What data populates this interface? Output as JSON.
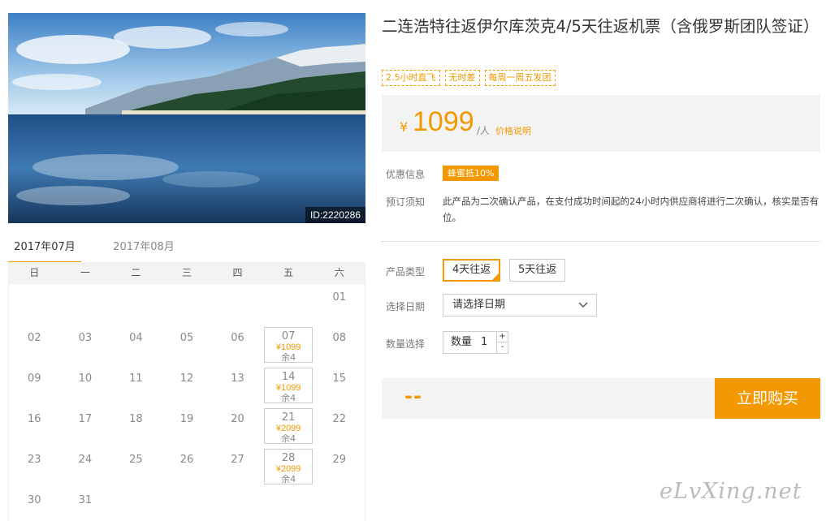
{
  "hero": {
    "image_id": "ID:2220286"
  },
  "product": {
    "title": "二连浩特往返伊尔库茨克4/5天往返机票（含俄罗斯团队签证）",
    "tags": [
      "2.5小时直飞",
      "无时差",
      "每周一周五发团"
    ]
  },
  "price": {
    "currency": "¥",
    "amount": "1099",
    "unit": "/人",
    "explain_link": "价格说明"
  },
  "promo": {
    "label": "优惠信息",
    "badge": "蜂蜜抵10%"
  },
  "notice": {
    "label": "预订须知",
    "text": "此产品为二次确认产品，在支付成功时间起的24小时内供应商将进行二次确认，核实是否有位。"
  },
  "options": {
    "type_label": "产品类型",
    "types": [
      "4天往返",
      "5天往返"
    ],
    "selected_type": "4天往返",
    "date_label": "选择日期",
    "date_placeholder": "请选择日期",
    "qty_label": "数量选择",
    "qty_text": "数量",
    "qty_value": "1",
    "plus": "+",
    "minus": "-"
  },
  "buy": {
    "total": "--",
    "button": "立即购买"
  },
  "calendar": {
    "tabs": [
      "2017年07月",
      "2017年08月"
    ],
    "active_tab": "2017年07月",
    "weekdays": [
      "日",
      "一",
      "二",
      "三",
      "四",
      "五",
      "六"
    ],
    "leading_blanks": 6,
    "days": [
      "01",
      "02",
      "03",
      "04",
      "05",
      "06",
      "07",
      "08",
      "09",
      "10",
      "11",
      "12",
      "13",
      "14",
      "15",
      "16",
      "17",
      "18",
      "19",
      "20",
      "21",
      "22",
      "23",
      "24",
      "25",
      "26",
      "27",
      "28",
      "29",
      "30",
      "31"
    ],
    "available": [
      {
        "day": "07",
        "price": "¥1099",
        "remain": "余4"
      },
      {
        "day": "14",
        "price": "¥1099",
        "remain": "余4"
      },
      {
        "day": "21",
        "price": "¥2099",
        "remain": "余4"
      },
      {
        "day": "28",
        "price": "¥2099",
        "remain": "余4"
      }
    ]
  },
  "watermark": "eLvXing.net",
  "colors": {
    "accent": "#f39800",
    "panel_bg": "#f3f3f3"
  }
}
